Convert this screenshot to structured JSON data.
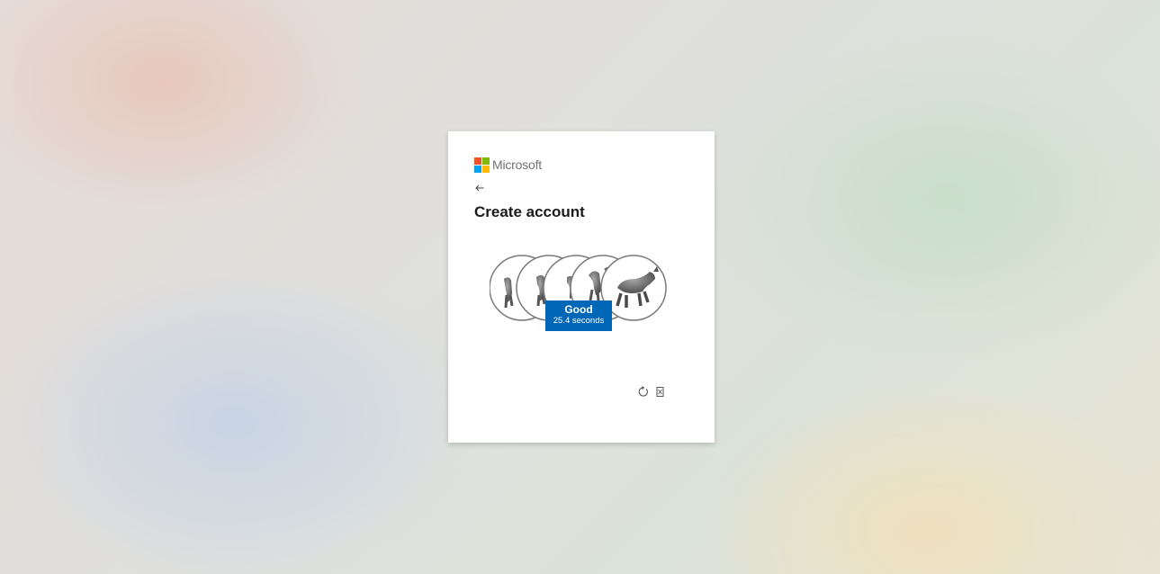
{
  "brand": {
    "name": "Microsoft",
    "logo_colors": [
      "#f25022",
      "#7fba00",
      "#00a4ef",
      "#ffb900"
    ]
  },
  "nav": {
    "back_icon": "arrow-left-icon"
  },
  "page": {
    "title": "Create account"
  },
  "puzzle": {
    "subject": "horse",
    "image_count": 5,
    "result": {
      "label": "Good",
      "time": "25.4 seconds",
      "color": "#0067b8"
    }
  },
  "tools": [
    {
      "icon": "refresh-icon"
    },
    {
      "icon": "audio-icon"
    }
  ]
}
